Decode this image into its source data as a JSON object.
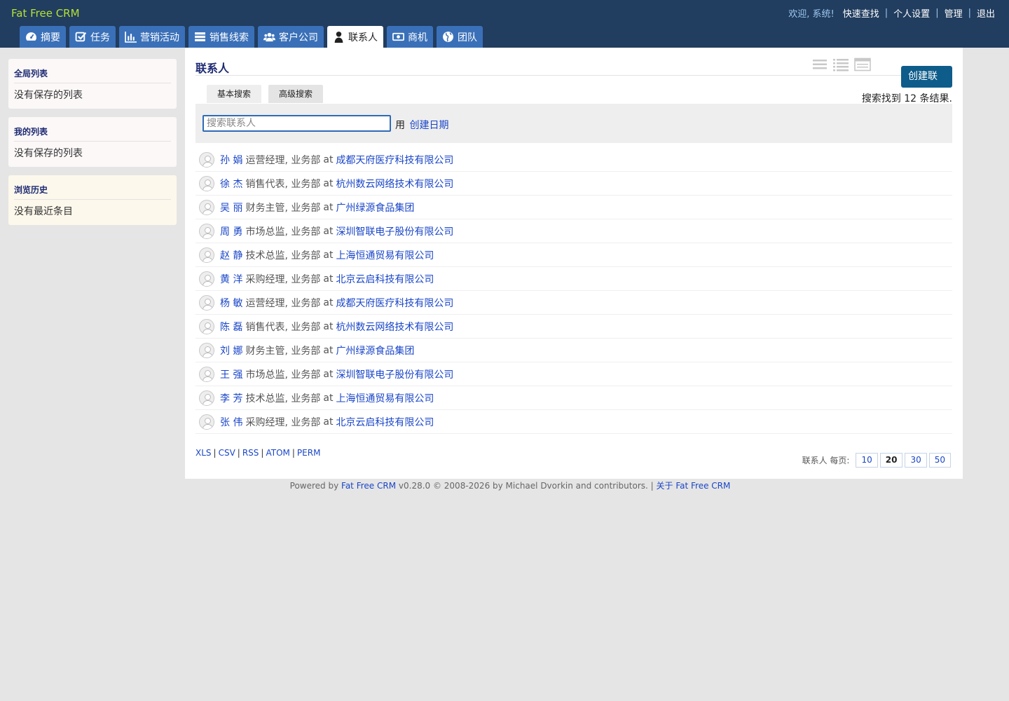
{
  "header": {
    "app_name": "Fat Free CRM",
    "welcome": "欢迎, 系统!",
    "links": [
      "快速查找",
      "个人设置",
      "管理",
      "退出"
    ]
  },
  "tabs": [
    {
      "label": "摘要",
      "icon": "dashboard-icon"
    },
    {
      "label": "任务",
      "icon": "check-square-icon"
    },
    {
      "label": "营销活动",
      "icon": "bar-chart-icon"
    },
    {
      "label": "销售线索",
      "icon": "list-rows-icon"
    },
    {
      "label": "客户公司",
      "icon": "users-icon"
    },
    {
      "label": "联系人",
      "icon": "user-icon",
      "active": true
    },
    {
      "label": "商机",
      "icon": "money-icon"
    },
    {
      "label": "团队",
      "icon": "globe-icon"
    }
  ],
  "sidebar": {
    "global_lists": {
      "title": "全局列表",
      "body": "没有保存的列表"
    },
    "my_lists": {
      "title": "我的列表",
      "body": "没有保存的列表"
    },
    "history": {
      "title": "浏览历史",
      "body": "没有最近条目"
    }
  },
  "main": {
    "title": "联系人",
    "create_button": "创建联系人",
    "search_tabs": [
      "基本搜索",
      "高级搜索"
    ],
    "result_count": "搜索找到 12 条结果.",
    "search_placeholder": "搜索联系人",
    "search_by_prefix": "用",
    "search_by_link": "创建日期",
    "contacts": [
      {
        "name": "孙 娟",
        "title": "运营经理, 业务部",
        "at": "at",
        "company": "成都天府医疗科技有限公司"
      },
      {
        "name": "徐 杰",
        "title": "销售代表, 业务部",
        "at": "at",
        "company": "杭州数云网络技术有限公司"
      },
      {
        "name": "吴 丽",
        "title": "财务主管, 业务部",
        "at": "at",
        "company": "广州绿源食品集团"
      },
      {
        "name": "周 勇",
        "title": "市场总监, 业务部",
        "at": "at",
        "company": "深圳智联电子股份有限公司"
      },
      {
        "name": "赵 静",
        "title": "技术总监, 业务部",
        "at": "at",
        "company": "上海恒通贸易有限公司"
      },
      {
        "name": "黄 洋",
        "title": "采购经理, 业务部",
        "at": "at",
        "company": "北京云启科技有限公司"
      },
      {
        "name": "杨 敏",
        "title": "运营经理, 业务部",
        "at": "at",
        "company": "成都天府医疗科技有限公司"
      },
      {
        "name": "陈 磊",
        "title": "销售代表, 业务部",
        "at": "at",
        "company": "杭州数云网络技术有限公司"
      },
      {
        "name": "刘 娜",
        "title": "财务主管, 业务部",
        "at": "at",
        "company": "广州绿源食品集团"
      },
      {
        "name": "王 强",
        "title": "市场总监, 业务部",
        "at": "at",
        "company": "深圳智联电子股份有限公司"
      },
      {
        "name": "李 芳",
        "title": "技术总监, 业务部",
        "at": "at",
        "company": "上海恒通贸易有限公司"
      },
      {
        "name": "张 伟",
        "title": "采购经理, 业务部",
        "at": "at",
        "company": "北京云启科技有限公司"
      }
    ],
    "export_links": [
      "XLS",
      "CSV",
      "RSS",
      "ATOM",
      "PERM"
    ],
    "per_page_label": "联系人 每页:",
    "per_page_options": [
      "10",
      "20",
      "30",
      "50"
    ],
    "per_page_selected": "20"
  },
  "footer": {
    "powered_by": "Powered by",
    "link": "Fat Free CRM",
    "text": "v0.28.0 © 2008-2026 by Michael Dvorkin and contributors. |",
    "about": "关于 Fat Free CRM"
  },
  "colors": {
    "header_bg": "#213d5f",
    "tab_bg": "#3a70b8",
    "app_name": "#b6e234",
    "link": "#1a46c8",
    "create_button": "#0e5c8a"
  }
}
